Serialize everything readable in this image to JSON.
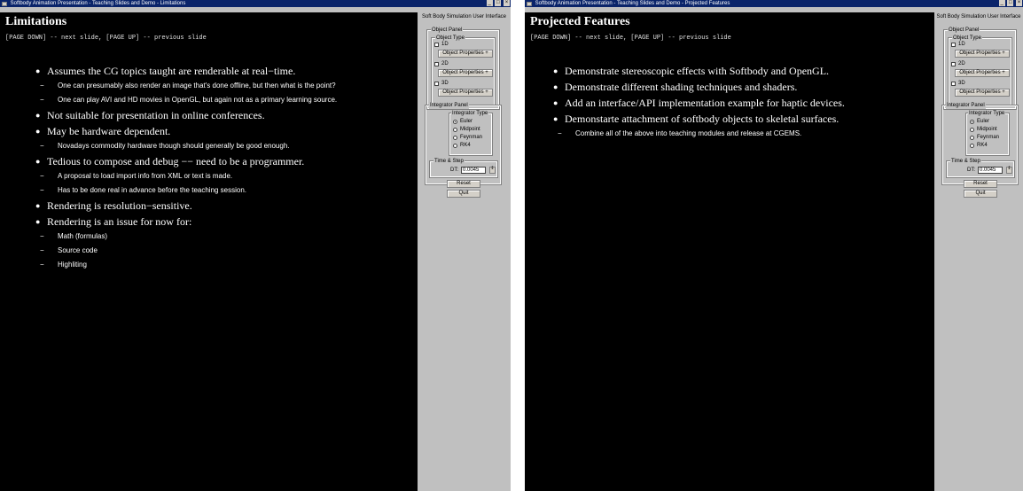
{
  "left_window": {
    "title": "Softbody Animation Presentation - Teaching Slides and Demo - Limitations",
    "controls": {
      "minimize": "_",
      "maximize": "□",
      "close": "×"
    },
    "slide": {
      "title": "Limitations",
      "nav_hint": "[PAGE DOWN] -- next slide, [PAGE UP] -- previous slide",
      "bullets": [
        {
          "text": "Assumes the CG topics taught are renderable at real−time.",
          "subs": [
            "One can presumably also render an image that's done offline, but then what is the point?",
            "One can play AVI and HD movies in OpenGL, but again not as a primary learning source."
          ]
        },
        {
          "text": "Not suitable for presentation in online conferences.",
          "subs": []
        },
        {
          "text": "May be hardware dependent.",
          "subs": [
            "Novadays commodity hardware though should generally be good enough."
          ]
        },
        {
          "text": "Tedious to compose and debug −− need to be a programmer.",
          "subs": [
            "A proposal to load import info from XML or text is made.",
            "Has to be done real in advance before the teaching session."
          ]
        },
        {
          "text": "Rendering is resolution−sensitive.",
          "subs": []
        },
        {
          "text": "Rendering is an issue for now for:",
          "subs": [
            "Math (formulas)",
            "Source code",
            "Highliting"
          ]
        }
      ]
    }
  },
  "right_window": {
    "title": "Softbody Animation Presentation - Teaching Slides and Demo - Projected Features",
    "controls": {
      "minimize": "_",
      "maximize": "□",
      "close": "×"
    },
    "slide": {
      "title": "Projected Features",
      "nav_hint": "[PAGE DOWN] -- next slide, [PAGE UP] -- previous slide",
      "bullets": [
        {
          "text": "Demonstrate stereoscopic effects with Softbody and OpenGL.",
          "subs": []
        },
        {
          "text": "Demonstrate different shading techniques and shaders.",
          "subs": []
        },
        {
          "text": "Add an interface/API implementation example for haptic devices.",
          "subs": []
        },
        {
          "text": "Demonstarte attachment of softbody objects to skeletal surfaces.",
          "subs": [
            "Combine all of the above into teaching modules and release at CGEMS."
          ]
        }
      ]
    }
  },
  "control_panel": {
    "heading": "Soft Body Simulation User Interface",
    "object_panel": {
      "label": "Object Panel",
      "object_type_label": "Object Type",
      "types": [
        "1D",
        "2D",
        "3D"
      ],
      "properties_button": "Object Properties +"
    },
    "integrator_panel": {
      "label": "Integrator Panel",
      "integrator_type_label": "Integrator Type",
      "options": [
        "Euler",
        "Midpoint",
        "Feynman",
        "RK4"
      ],
      "selected": "Euler"
    },
    "time_step": {
      "label": "Time & Step",
      "dt_label": "DT:",
      "dt_value": "0.0045",
      "spinner_glyph": "⇕"
    },
    "reset_button": "Reset",
    "quit_button": "Quit"
  },
  "glyphs": {
    "bullet": "●",
    "dash": "−"
  },
  "colors": {
    "titlebar": "#0a246a",
    "slide_bg": "#000000",
    "panel_bg": "#c0c0c0",
    "text": "#ffffff"
  }
}
